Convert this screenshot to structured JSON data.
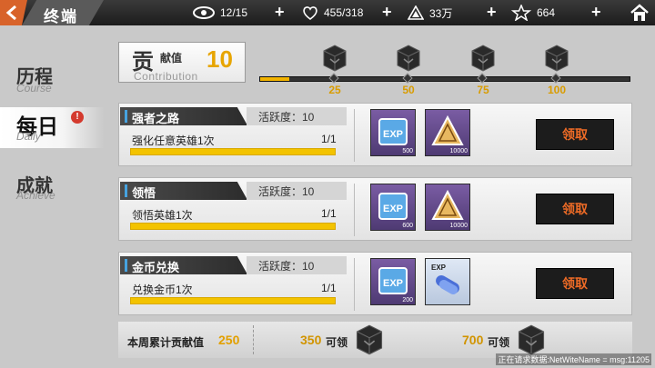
{
  "topbar": {
    "title": "终端",
    "resources": [
      {
        "icon": "eye-icon",
        "value": "12/15"
      },
      {
        "icon": "heart-emblem-icon",
        "value": "455/318"
      },
      {
        "icon": "triangle-crystal-icon",
        "value": "33万"
      },
      {
        "icon": "star-wing-icon",
        "value": "664"
      }
    ],
    "plus": "+"
  },
  "sidebar": {
    "items": [
      {
        "cn": "历程",
        "en": "Course"
      },
      {
        "cn": "每日",
        "en": "Daily",
        "badge": "!"
      },
      {
        "cn": "成就",
        "en": "Achieve"
      }
    ]
  },
  "contribution": {
    "big": "贡",
    "small": "献值",
    "value": "10",
    "en": "Contribution",
    "progress_fraction": 0.08,
    "milestones": [
      "25",
      "50",
      "75",
      "100"
    ]
  },
  "tasks": [
    {
      "name": "强者之路",
      "activity": "活跃度：10",
      "desc": "强化任意英雄1次",
      "count": "1/1",
      "rewards": [
        {
          "icon": "exp-book-icon",
          "label": "EXP",
          "qty": "500"
        },
        {
          "icon": "gold-triangle-icon",
          "label": "",
          "qty": "10000"
        }
      ],
      "claim": "领取"
    },
    {
      "name": "领悟",
      "activity": "活跃度：10",
      "desc": "领悟英雄1次",
      "count": "1/1",
      "rewards": [
        {
          "icon": "exp-book-icon",
          "label": "EXP",
          "qty": "600"
        },
        {
          "icon": "gold-triangle-icon",
          "label": "",
          "qty": "10000"
        }
      ],
      "claim": "领取"
    },
    {
      "name": "金币兑换",
      "activity": "活跃度：10",
      "desc": "兑换金币1次",
      "count": "1/1",
      "rewards": [
        {
          "icon": "exp-book-icon",
          "label": "EXP",
          "qty": "200"
        },
        {
          "icon": "exp-capsule-icon",
          "label": "EXP",
          "qty": ""
        }
      ],
      "claim": "领取"
    }
  ],
  "footer": {
    "label": "本周累计贡献值",
    "value": "250",
    "tiers": [
      {
        "num": "350",
        "label": "可领"
      },
      {
        "num": "700",
        "label": "可领"
      }
    ]
  },
  "status": "正在请求数据:NetWiteName = msg:11205",
  "colors": {
    "accent": "#ee6b26",
    "gold": "#f2b300",
    "dark": "#1c1c1c"
  }
}
